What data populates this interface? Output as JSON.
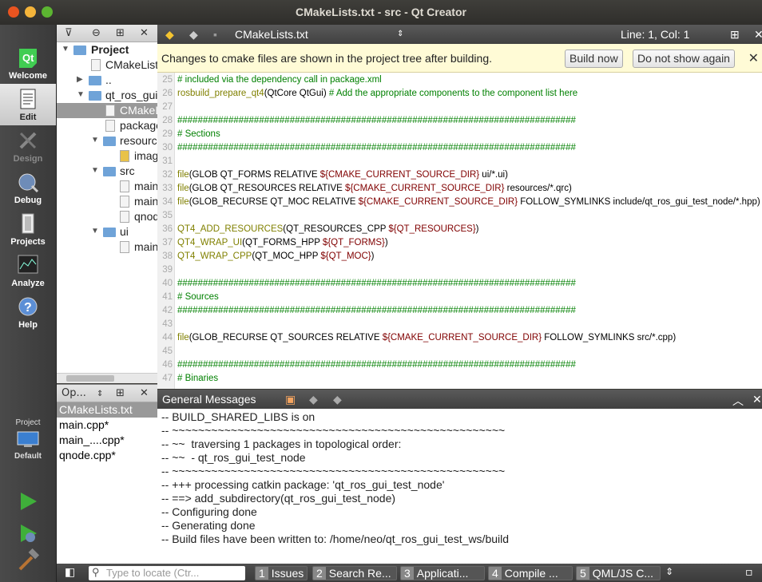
{
  "window": {
    "title": "CMakeLists.txt - src - Qt Creator"
  },
  "modebar": {
    "modes": [
      {
        "label": "Welcome",
        "icon": "qt-logo-icon"
      },
      {
        "label": "Edit",
        "icon": "edit-document-icon"
      },
      {
        "label": "Design",
        "icon": "design-tools-icon"
      },
      {
        "label": "Debug",
        "icon": "bug-icon"
      },
      {
        "label": "Projects",
        "icon": "projects-icon"
      },
      {
        "label": "Analyze",
        "icon": "analyze-icon"
      },
      {
        "label": "Help",
        "icon": "help-icon"
      }
    ],
    "kit_project": "Project",
    "kit_config": "Default"
  },
  "project_tree": {
    "items": [
      {
        "label": "Project",
        "type": "folder"
      },
      {
        "label": "CMakeLists.txt",
        "type": "file"
      },
      {
        "label": "..",
        "type": "folder"
      },
      {
        "label": "qt_ros_gui_test_node",
        "type": "folder"
      },
      {
        "label": "CMakeLists.txt",
        "type": "file"
      },
      {
        "label": "package.xml",
        "type": "file"
      },
      {
        "label": "resources",
        "type": "folder"
      },
      {
        "label": "images",
        "type": "file"
      },
      {
        "label": "src",
        "type": "folder"
      },
      {
        "label": "main.cpp",
        "type": "file"
      },
      {
        "label": "main_window.cpp",
        "type": "file"
      },
      {
        "label": "qnode.cpp",
        "type": "file"
      },
      {
        "label": "ui",
        "type": "folder"
      },
      {
        "label": "main_window.ui",
        "type": "file"
      }
    ]
  },
  "open_documents": {
    "title": "Op...",
    "items": [
      "CMakeLists.txt",
      "main.cpp*",
      "main_....cpp*",
      "qnode.cpp*"
    ]
  },
  "editor": {
    "filename": "CMakeLists.txt",
    "position": "Line: 1, Col: 1",
    "info_message": "Changes to cmake files are shown in the project tree after building.",
    "build_now": "Build now",
    "dont_show": "Do not show again",
    "lines": [
      {
        "n": "25",
        "code": "# included via the dependency call in package.xml"
      },
      {
        "n": "26",
        "code": "rosbuild_prepare_qt4(QtCore QtGui) # Add the appropriate components to the component list here"
      },
      {
        "n": "27",
        "code": ""
      },
      {
        "n": "28",
        "code": "##############################################################################"
      },
      {
        "n": "29",
        "code": "# Sections"
      },
      {
        "n": "30",
        "code": "##############################################################################"
      },
      {
        "n": "31",
        "code": ""
      },
      {
        "n": "32",
        "code": "file(GLOB QT_FORMS RELATIVE ${CMAKE_CURRENT_SOURCE_DIR} ui/*.ui)"
      },
      {
        "n": "33",
        "code": "file(GLOB QT_RESOURCES RELATIVE ${CMAKE_CURRENT_SOURCE_DIR} resources/*.qrc)"
      },
      {
        "n": "34",
        "code": "file(GLOB_RECURSE QT_MOC RELATIVE ${CMAKE_CURRENT_SOURCE_DIR} FOLLOW_SYMLINKS include/qt_ros_gui_test_node/*.hpp)"
      },
      {
        "n": "35",
        "code": ""
      },
      {
        "n": "36",
        "code": "QT4_ADD_RESOURCES(QT_RESOURCES_CPP ${QT_RESOURCES})"
      },
      {
        "n": "37",
        "code": "QT4_WRAP_UI(QT_FORMS_HPP ${QT_FORMS})"
      },
      {
        "n": "38",
        "code": "QT4_WRAP_CPP(QT_MOC_HPP ${QT_MOC})"
      },
      {
        "n": "39",
        "code": ""
      },
      {
        "n": "40",
        "code": "##############################################################################"
      },
      {
        "n": "41",
        "code": "# Sources"
      },
      {
        "n": "42",
        "code": "##############################################################################"
      },
      {
        "n": "43",
        "code": ""
      },
      {
        "n": "44",
        "code": "file(GLOB_RECURSE QT_SOURCES RELATIVE ${CMAKE_CURRENT_SOURCE_DIR} FOLLOW_SYMLINKS src/*.cpp)"
      },
      {
        "n": "45",
        "code": ""
      },
      {
        "n": "46",
        "code": "##############################################################################"
      },
      {
        "n": "47",
        "code": "# Binaries"
      }
    ]
  },
  "output": {
    "title": "General Messages",
    "lines": [
      "-- BUILD_SHARED_LIBS is on",
      "-- ~~~~~~~~~~~~~~~~~~~~~~~~~~~~~~~~~~~~~~~~~~~~~~~~~~~",
      "-- ~~  traversing 1 packages in topological order:",
      "-- ~~  - qt_ros_gui_test_node",
      "-- ~~~~~~~~~~~~~~~~~~~~~~~~~~~~~~~~~~~~~~~~~~~~~~~~~~~",
      "-- +++ processing catkin package: 'qt_ros_gui_test_node'",
      "-- ==> add_subdirectory(qt_ros_gui_test_node)",
      "-- Configuring done",
      "-- Generating done",
      "-- Build files have been written to: /home/neo/qt_ros_gui_test_ws/build"
    ]
  },
  "statusbar": {
    "locate_placeholder": "Type to locate (Ctr...",
    "tabs": [
      {
        "num": "1",
        "label": "Issues"
      },
      {
        "num": "2",
        "label": "Search Re..."
      },
      {
        "num": "3",
        "label": "Applicati..."
      },
      {
        "num": "4",
        "label": "Compile ..."
      },
      {
        "num": "5",
        "label": "QML/JS C..."
      }
    ]
  },
  "colors": {
    "accent": "#e95420",
    "comment": "#008000",
    "function": "#808000",
    "variable": "#800000"
  }
}
